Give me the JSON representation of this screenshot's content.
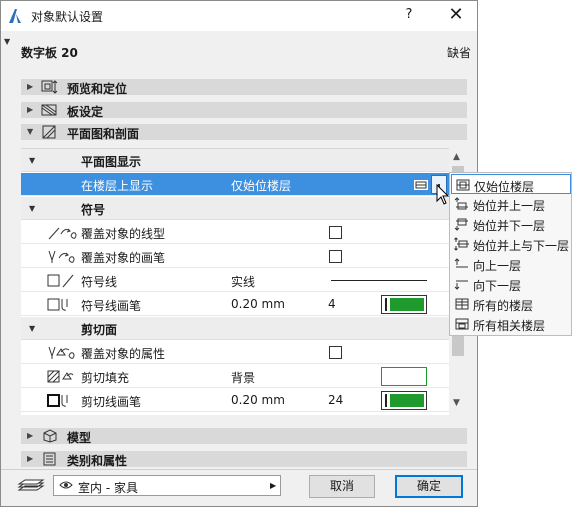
{
  "window": {
    "title": "对象默认设置",
    "help_label": "?",
    "close_label": "✕"
  },
  "header": {
    "device_name": "数字板 20",
    "default_label": "缺省"
  },
  "sections": {
    "preview": "预览和定位",
    "slab": "板设定",
    "plan_section": "平面图和剖面",
    "model": "模型",
    "classification": "类别和属性"
  },
  "plan": {
    "display_group": "平面图显示",
    "show_on_stories": {
      "label": "在楼层上显示",
      "value": "仅始位楼层"
    },
    "symbol_group": "符号",
    "override_linetype": "覆盖对象的线型",
    "override_pen": "覆盖对象的画笔",
    "symbol_lines": {
      "label": "符号线",
      "value": "实线"
    },
    "symbol_line_pen": {
      "label": "符号线画笔",
      "value": "0.20 mm",
      "pen": "4"
    },
    "cut_group": "剪切面",
    "override_attributes": "覆盖对象的属性",
    "cut_fill": {
      "label": "剪切填充",
      "value": "背景"
    },
    "cut_line_pen": {
      "label": "剪切线画笔",
      "value": "0.20 mm",
      "pen": "24"
    }
  },
  "story_menu": {
    "items": [
      "仅始位楼层",
      "始位并上一层",
      "始位并下一层",
      "始位并上与下一层",
      "向上一层",
      "向下一层",
      "所有的楼层",
      "所有相关楼层"
    ],
    "selected": "仅始位楼层"
  },
  "footer": {
    "layer": "室内 - 家具",
    "cancel_label": "取消",
    "ok_label": "确定"
  },
  "icons": {
    "app_logo": "archicad-logo-icon",
    "pen_color": "#1f9a2c",
    "selection_color": "#3d8fe0"
  }
}
